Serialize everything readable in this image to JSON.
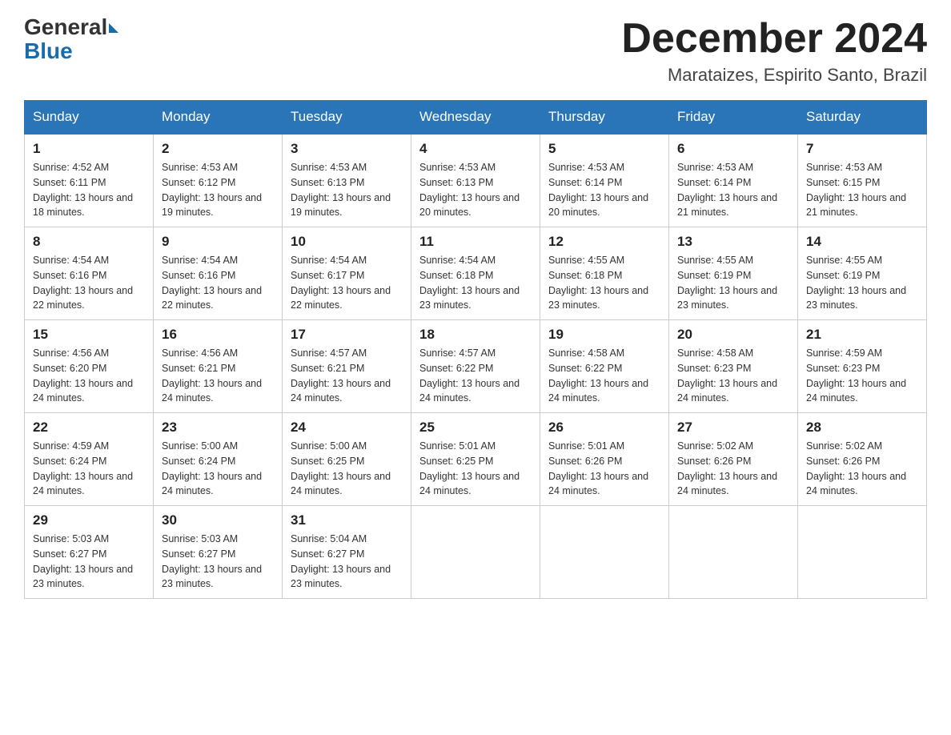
{
  "header": {
    "logo_general": "General",
    "logo_blue": "Blue",
    "title": "December 2024",
    "subtitle": "Marataizes, Espirito Santo, Brazil"
  },
  "days_of_week": [
    "Sunday",
    "Monday",
    "Tuesday",
    "Wednesday",
    "Thursday",
    "Friday",
    "Saturday"
  ],
  "weeks": [
    [
      {
        "day": "1",
        "sunrise": "4:52 AM",
        "sunset": "6:11 PM",
        "daylight": "13 hours and 18 minutes."
      },
      {
        "day": "2",
        "sunrise": "4:53 AM",
        "sunset": "6:12 PM",
        "daylight": "13 hours and 19 minutes."
      },
      {
        "day": "3",
        "sunrise": "4:53 AM",
        "sunset": "6:13 PM",
        "daylight": "13 hours and 19 minutes."
      },
      {
        "day": "4",
        "sunrise": "4:53 AM",
        "sunset": "6:13 PM",
        "daylight": "13 hours and 20 minutes."
      },
      {
        "day": "5",
        "sunrise": "4:53 AM",
        "sunset": "6:14 PM",
        "daylight": "13 hours and 20 minutes."
      },
      {
        "day": "6",
        "sunrise": "4:53 AM",
        "sunset": "6:14 PM",
        "daylight": "13 hours and 21 minutes."
      },
      {
        "day": "7",
        "sunrise": "4:53 AM",
        "sunset": "6:15 PM",
        "daylight": "13 hours and 21 minutes."
      }
    ],
    [
      {
        "day": "8",
        "sunrise": "4:54 AM",
        "sunset": "6:16 PM",
        "daylight": "13 hours and 22 minutes."
      },
      {
        "day": "9",
        "sunrise": "4:54 AM",
        "sunset": "6:16 PM",
        "daylight": "13 hours and 22 minutes."
      },
      {
        "day": "10",
        "sunrise": "4:54 AM",
        "sunset": "6:17 PM",
        "daylight": "13 hours and 22 minutes."
      },
      {
        "day": "11",
        "sunrise": "4:54 AM",
        "sunset": "6:18 PM",
        "daylight": "13 hours and 23 minutes."
      },
      {
        "day": "12",
        "sunrise": "4:55 AM",
        "sunset": "6:18 PM",
        "daylight": "13 hours and 23 minutes."
      },
      {
        "day": "13",
        "sunrise": "4:55 AM",
        "sunset": "6:19 PM",
        "daylight": "13 hours and 23 minutes."
      },
      {
        "day": "14",
        "sunrise": "4:55 AM",
        "sunset": "6:19 PM",
        "daylight": "13 hours and 23 minutes."
      }
    ],
    [
      {
        "day": "15",
        "sunrise": "4:56 AM",
        "sunset": "6:20 PM",
        "daylight": "13 hours and 24 minutes."
      },
      {
        "day": "16",
        "sunrise": "4:56 AM",
        "sunset": "6:21 PM",
        "daylight": "13 hours and 24 minutes."
      },
      {
        "day": "17",
        "sunrise": "4:57 AM",
        "sunset": "6:21 PM",
        "daylight": "13 hours and 24 minutes."
      },
      {
        "day": "18",
        "sunrise": "4:57 AM",
        "sunset": "6:22 PM",
        "daylight": "13 hours and 24 minutes."
      },
      {
        "day": "19",
        "sunrise": "4:58 AM",
        "sunset": "6:22 PM",
        "daylight": "13 hours and 24 minutes."
      },
      {
        "day": "20",
        "sunrise": "4:58 AM",
        "sunset": "6:23 PM",
        "daylight": "13 hours and 24 minutes."
      },
      {
        "day": "21",
        "sunrise": "4:59 AM",
        "sunset": "6:23 PM",
        "daylight": "13 hours and 24 minutes."
      }
    ],
    [
      {
        "day": "22",
        "sunrise": "4:59 AM",
        "sunset": "6:24 PM",
        "daylight": "13 hours and 24 minutes."
      },
      {
        "day": "23",
        "sunrise": "5:00 AM",
        "sunset": "6:24 PM",
        "daylight": "13 hours and 24 minutes."
      },
      {
        "day": "24",
        "sunrise": "5:00 AM",
        "sunset": "6:25 PM",
        "daylight": "13 hours and 24 minutes."
      },
      {
        "day": "25",
        "sunrise": "5:01 AM",
        "sunset": "6:25 PM",
        "daylight": "13 hours and 24 minutes."
      },
      {
        "day": "26",
        "sunrise": "5:01 AM",
        "sunset": "6:26 PM",
        "daylight": "13 hours and 24 minutes."
      },
      {
        "day": "27",
        "sunrise": "5:02 AM",
        "sunset": "6:26 PM",
        "daylight": "13 hours and 24 minutes."
      },
      {
        "day": "28",
        "sunrise": "5:02 AM",
        "sunset": "6:26 PM",
        "daylight": "13 hours and 24 minutes."
      }
    ],
    [
      {
        "day": "29",
        "sunrise": "5:03 AM",
        "sunset": "6:27 PM",
        "daylight": "13 hours and 23 minutes."
      },
      {
        "day": "30",
        "sunrise": "5:03 AM",
        "sunset": "6:27 PM",
        "daylight": "13 hours and 23 minutes."
      },
      {
        "day": "31",
        "sunrise": "5:04 AM",
        "sunset": "6:27 PM",
        "daylight": "13 hours and 23 minutes."
      },
      null,
      null,
      null,
      null
    ]
  ],
  "labels": {
    "sunrise": "Sunrise:",
    "sunset": "Sunset:",
    "daylight": "Daylight:"
  }
}
